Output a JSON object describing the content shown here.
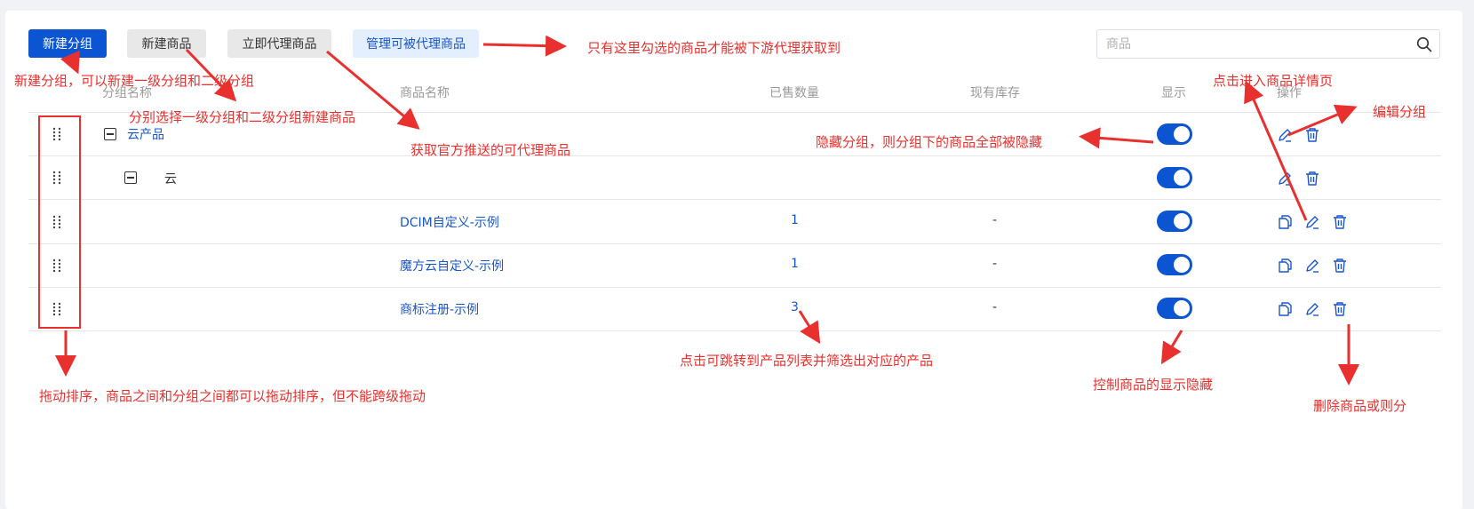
{
  "toolbar": {
    "new_group": "新建分组",
    "new_product": "新建商品",
    "proxy_product": "立即代理商品",
    "manage_proxy": "管理可被代理商品"
  },
  "search": {
    "placeholder": "商品"
  },
  "table": {
    "headers": {
      "group_name": "分组名称",
      "product_name": "商品名称",
      "sold": "已售数量",
      "stock": "现有库存",
      "display": "显示",
      "ops": "操作"
    },
    "rows": [
      {
        "group": "云产品",
        "product": "",
        "sold": "",
        "stock": "",
        "display": true
      },
      {
        "group": "云",
        "product": "",
        "sold": "",
        "stock": "",
        "display": true
      },
      {
        "group": "",
        "product": "DCIM自定义-示例",
        "sold": "1",
        "stock": "-",
        "display": true
      },
      {
        "group": "",
        "product": "魔方云自定义-示例",
        "sold": "1",
        "stock": "-",
        "display": true
      },
      {
        "group": "",
        "product": "商标注册-示例",
        "sold": "3",
        "stock": "-",
        "display": true
      }
    ]
  },
  "annotations": {
    "proxy_only": "只有这里勾选的商品才能被下游代理获取到",
    "new_group_hint": "新建分组，可以新建一级分组和二级分组",
    "new_product_hint": "分别选择一级分组和二级分组新建商品",
    "proxy_hint": "获取官方推送的可代理商品",
    "hide_group_hint": "隐藏分组，则分组下的商品全部被隐藏",
    "detail_hint": "点击进入商品详情页",
    "edit_group_hint": "编辑分组",
    "sold_hint": "点击可跳转到产品列表并筛选出对应的产品",
    "toggle_hint": "控制商品的显示隐藏",
    "delete_hint": "删除商品或则分",
    "drag_hint": "拖动排序，商品之间和分组之间都可以拖动排序，但不能跨级拖动"
  },
  "colors": {
    "primary": "#0b55d3",
    "link": "#1a56c8",
    "annotation": "#e8302e"
  }
}
